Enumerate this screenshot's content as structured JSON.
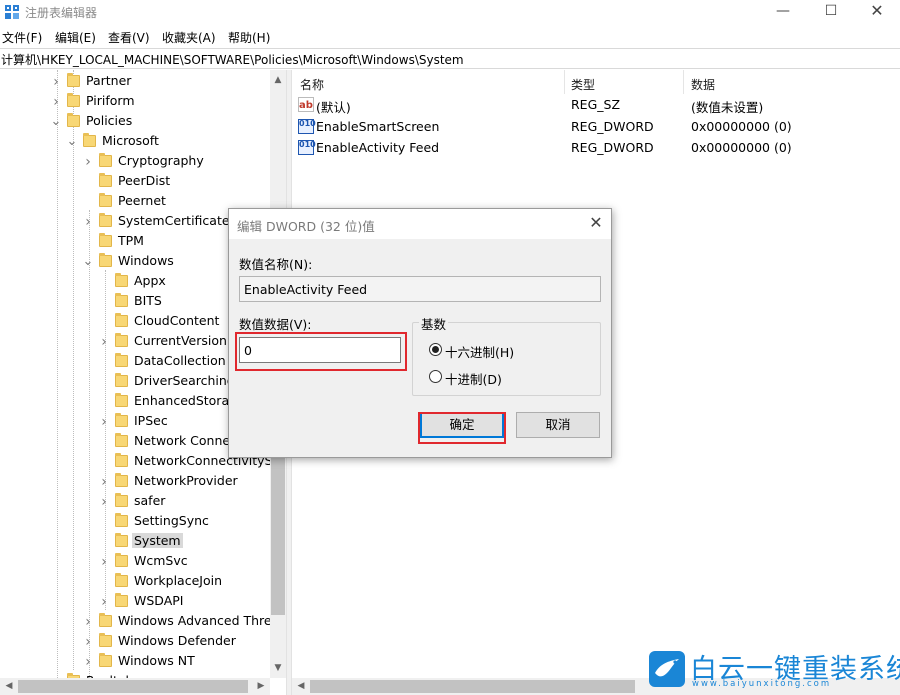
{
  "window": {
    "title": "注册表编辑器",
    "min_glyph": "—",
    "max_glyph": "☐",
    "close_glyph": "✕"
  },
  "menu": [
    "文件(F)",
    "编辑(E)",
    "查看(V)",
    "收藏夹(A)",
    "帮助(H)"
  ],
  "address": "计算机\\HKEY_LOCAL_MACHINE\\SOFTWARE\\Policies\\Microsoft\\Windows\\System",
  "tree": {
    "items": [
      {
        "label": "Partner",
        "level": 1,
        "expander": "collapsed"
      },
      {
        "label": "Piriform",
        "level": 1,
        "expander": "collapsed"
      },
      {
        "label": "Policies",
        "level": 1,
        "expander": "expanded"
      },
      {
        "label": "Microsoft",
        "level": 2,
        "expander": "expanded"
      },
      {
        "label": "Cryptography",
        "level": 3,
        "expander": "collapsed"
      },
      {
        "label": "PeerDist",
        "level": 3,
        "expander": "none"
      },
      {
        "label": "Peernet",
        "level": 3,
        "expander": "none"
      },
      {
        "label": "SystemCertificates",
        "level": 3,
        "expander": "collapsed"
      },
      {
        "label": "TPM",
        "level": 3,
        "expander": "none"
      },
      {
        "label": "Windows",
        "level": 3,
        "expander": "expanded"
      },
      {
        "label": "Appx",
        "level": 4,
        "expander": "none"
      },
      {
        "label": "BITS",
        "level": 4,
        "expander": "none"
      },
      {
        "label": "CloudContent",
        "level": 4,
        "expander": "none"
      },
      {
        "label": "CurrentVersion",
        "level": 4,
        "expander": "collapsed"
      },
      {
        "label": "DataCollection",
        "level": 4,
        "expander": "none"
      },
      {
        "label": "DriverSearching",
        "level": 4,
        "expander": "none"
      },
      {
        "label": "EnhancedStorageDevices",
        "level": 4,
        "expander": "none"
      },
      {
        "label": "IPSec",
        "level": 4,
        "expander": "collapsed"
      },
      {
        "label": "Network Connections",
        "level": 4,
        "expander": "none"
      },
      {
        "label": "NetworkConnectivityStatusIndicator",
        "level": 4,
        "expander": "none"
      },
      {
        "label": "NetworkProvider",
        "level": 4,
        "expander": "collapsed"
      },
      {
        "label": "safer",
        "level": 4,
        "expander": "collapsed"
      },
      {
        "label": "SettingSync",
        "level": 4,
        "expander": "none"
      },
      {
        "label": "System",
        "level": 4,
        "expander": "none",
        "selected": true
      },
      {
        "label": "WcmSvc",
        "level": 4,
        "expander": "collapsed"
      },
      {
        "label": "WorkplaceJoin",
        "level": 4,
        "expander": "none"
      },
      {
        "label": "WSDAPI",
        "level": 4,
        "expander": "collapsed"
      },
      {
        "label": "Windows Advanced Threat Protection",
        "level": 3,
        "expander": "collapsed"
      },
      {
        "label": "Windows Defender",
        "level": 3,
        "expander": "collapsed"
      },
      {
        "label": "Windows NT",
        "level": 3,
        "expander": "collapsed"
      },
      {
        "label": "Realtek",
        "level": 1,
        "expander": "collapsed"
      }
    ]
  },
  "list": {
    "columns": [
      "名称",
      "类型",
      "数据"
    ],
    "rows": [
      {
        "name": "(默认)",
        "type": "REG_SZ",
        "data": "(数值未设置)",
        "icon": "string-value-icon",
        "icon_glyph": "ab"
      },
      {
        "name": "EnableSmartScreen",
        "type": "REG_DWORD",
        "data": "0x00000000 (0)",
        "icon": "dword-value-icon",
        "icon_glyph": "010"
      },
      {
        "name": "EnableActivity Feed",
        "type": "REG_DWORD",
        "data": "0x00000000 (0)",
        "icon": "dword-value-icon",
        "icon_glyph": "010"
      }
    ]
  },
  "dialog": {
    "title": "编辑 DWORD (32 位)值",
    "close_glyph": "✕",
    "name_label": "数值名称(N):",
    "name_value": "EnableActivity Feed",
    "data_label": "数值数据(V):",
    "data_value": "0",
    "base_label": "基数",
    "hex_label": "十六进制(H)",
    "dec_label": "十进制(D)",
    "base_selected": "hex",
    "ok_label": "确定",
    "cancel_label": "取消",
    "highlight_color": "#e0282e"
  },
  "watermark": {
    "title": "白云一键重装系统",
    "url": "www.baiyunxitong.com",
    "color": "#1a86d6"
  },
  "scroll_glyphs": {
    "up": "▲",
    "down": "▼",
    "left": "◀",
    "right": "▶"
  }
}
